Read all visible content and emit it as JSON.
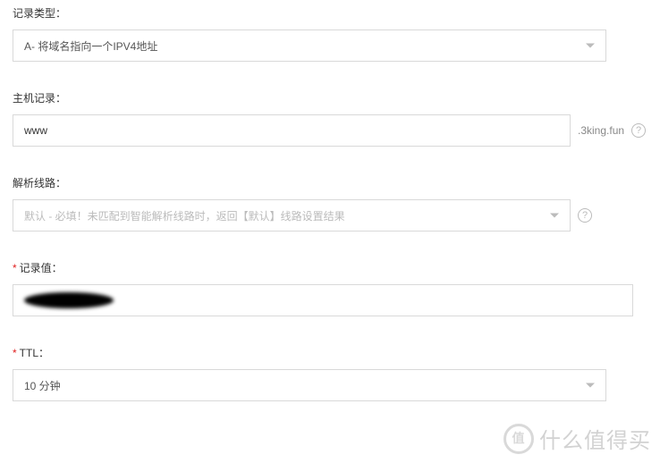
{
  "fields": {
    "record_type": {
      "label": "记录类型：",
      "value": "A- 将域名指向一个IPV4地址",
      "required": false
    },
    "host_record": {
      "label": "主机记录：",
      "value": "www",
      "suffix": ".3king.fun",
      "required": false
    },
    "resolve_line": {
      "label": "解析线路：",
      "value": "默认 - 必填！未匹配到智能解析线路时，返回【默认】线路设置结果",
      "required": false
    },
    "record_value": {
      "label": "记录值：",
      "value": "",
      "required": true
    },
    "ttl": {
      "label": "TTL：",
      "value": "10 分钟",
      "required": true
    }
  },
  "help_tooltip": "?",
  "watermark": "什么值得买"
}
